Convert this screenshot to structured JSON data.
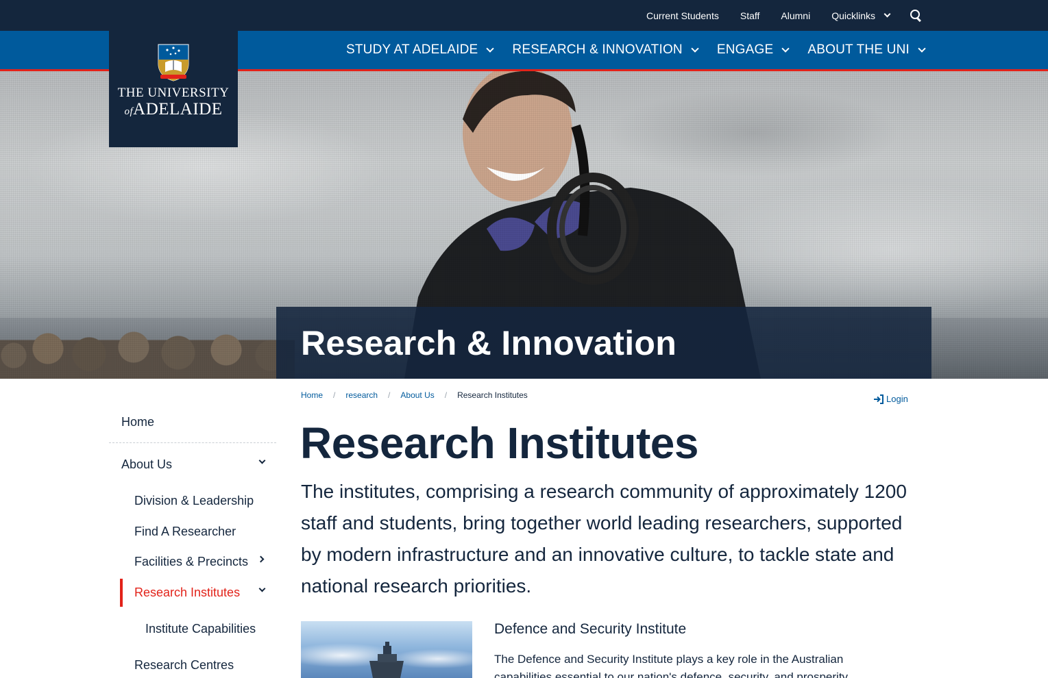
{
  "utility_nav": {
    "links": [
      "Current Students",
      "Staff",
      "Alumni"
    ],
    "quicklinks_label": "Quicklinks",
    "search_icon": "search-icon"
  },
  "logo": {
    "line1": "THE UNIVERSITY",
    "line2_of": "of",
    "line2_name": "ADELAIDE",
    "crest_icon": "university-crest"
  },
  "main_nav": {
    "items": [
      "STUDY AT ADELAIDE",
      "RESEARCH & INNOVATION",
      "ENGAGE",
      "ABOUT THE UNI"
    ]
  },
  "hero": {
    "title": "Research & Innovation"
  },
  "breadcrumb": {
    "items": [
      "Home",
      "research",
      "About Us"
    ],
    "current": "Research Institutes"
  },
  "login": {
    "label": "Login",
    "icon": "login-icon"
  },
  "sidebar": {
    "home": "Home",
    "about_us": "About Us",
    "division_leadership": "Division & Leadership",
    "find_researcher": "Find A Researcher",
    "facilities_precincts": "Facilities & Precincts",
    "research_institutes": "Research Institutes",
    "institute_capabilities": "Institute Capabilities",
    "research_centres": "Research Centres"
  },
  "main": {
    "title": "Research Institutes",
    "intro": "The institutes, comprising a research community of approximately 1200 staff and students, bring together world leading researchers, supported by modern infrastructure and an innovative culture, to tackle state and national research priorities.",
    "card": {
      "title": "Defence and Security Institute",
      "text": "The Defence and Security Institute plays a key role in the Australian capabilities essential to our nation's defence, security, and prosperity."
    }
  },
  "colors": {
    "navy": "#14263d",
    "blue": "#005a9c",
    "red": "#e2231a"
  }
}
